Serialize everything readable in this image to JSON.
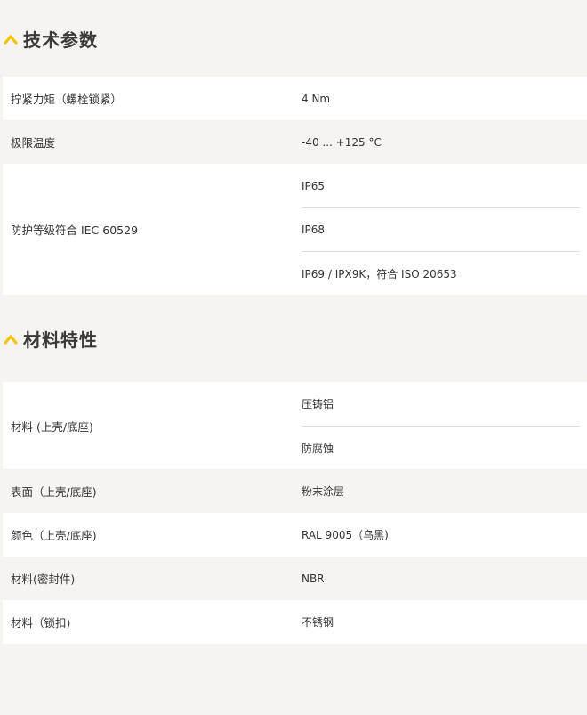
{
  "colors": {
    "accent": "#f5c400",
    "stripe": "#f5f4f0",
    "white": "#ffffff"
  },
  "sections": [
    {
      "title": "技术参数",
      "icon": "chevron-up-icon",
      "rows": [
        {
          "label": "拧紧力矩（螺栓锁紧）",
          "values": [
            " 4 Nm"
          ]
        },
        {
          "label": "极限温度",
          "values": [
            "-40 ... +125 °C"
          ]
        },
        {
          "label": "防护等级符合 IEC 60529",
          "values": [
            "IP65",
            "IP68",
            "IP69 / IPX9K，符合 ISO 20653"
          ]
        }
      ]
    },
    {
      "title": "材料特性",
      "icon": "chevron-up-icon",
      "rows": [
        {
          "label": "材料 (上壳/底座)",
          "values": [
            "压铸铝",
            "防腐蚀"
          ]
        },
        {
          "label": "表面（上壳/底座)",
          "values": [
            "粉末涂层"
          ]
        },
        {
          "label": "颜色（上壳/底座)",
          "values": [
            "RAL 9005（乌黑)"
          ]
        },
        {
          "label": "材料(密封件)",
          "values": [
            "NBR"
          ]
        },
        {
          "label": "材料（锁扣)",
          "values": [
            "不锈钢"
          ]
        }
      ]
    }
  ]
}
